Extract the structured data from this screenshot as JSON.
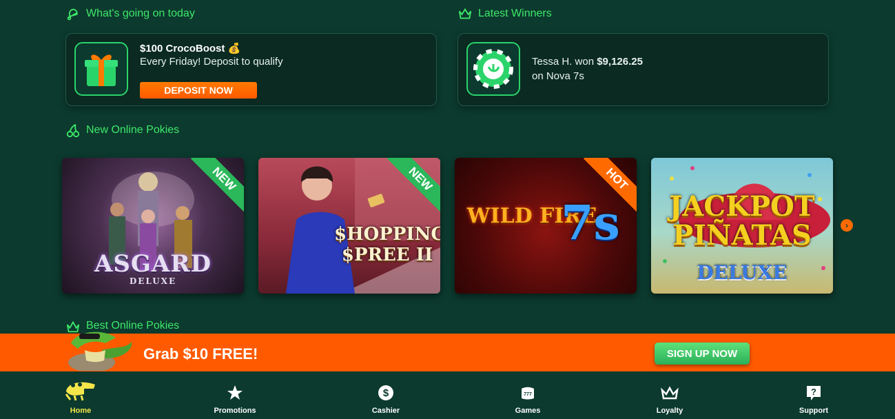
{
  "sections": {
    "today": "What's going on today",
    "winners": "Latest Winners",
    "new_pokies": "New Online Pokies",
    "best_pokies": "Best Online Pokies"
  },
  "promo": {
    "title": "$100 CrocoBoost 💰",
    "subtitle": "Every Friday! Deposit to qualify",
    "button": "DEPOSIT NOW"
  },
  "winner": {
    "prefix": "Tessa H. won ",
    "amount": "$9,126.25",
    "game": "on Nova 7s"
  },
  "games": [
    {
      "line1": "ASGARD",
      "line2": "DELUXE",
      "badge": "NEW",
      "badge_color": "#2bb85a"
    },
    {
      "line1": "$HOPPING",
      "line2": "$PREE II",
      "badge": "NEW",
      "badge_color": "#2bb85a"
    },
    {
      "line1": "WILD FIRE",
      "line2": "7s",
      "badge": "HOT",
      "badge_color": "#ff6a00"
    },
    {
      "line1": "JACKPOT PIÑATAS",
      "line2": "DELUXE",
      "badge": "",
      "badge_color": ""
    }
  ],
  "banner": {
    "text": "Grab $10 FREE!",
    "button": "SIGN UP NOW"
  },
  "nav": {
    "home": "Home",
    "promotions": "Promotions",
    "cashier": "Cashier",
    "games": "Games",
    "loyalty": "Loyalty",
    "support": "Support"
  },
  "colors": {
    "background": "#0c3a2e",
    "accent_green": "#3ee86a",
    "orange": "#ff5a00",
    "active_nav": "#f4e64a"
  }
}
